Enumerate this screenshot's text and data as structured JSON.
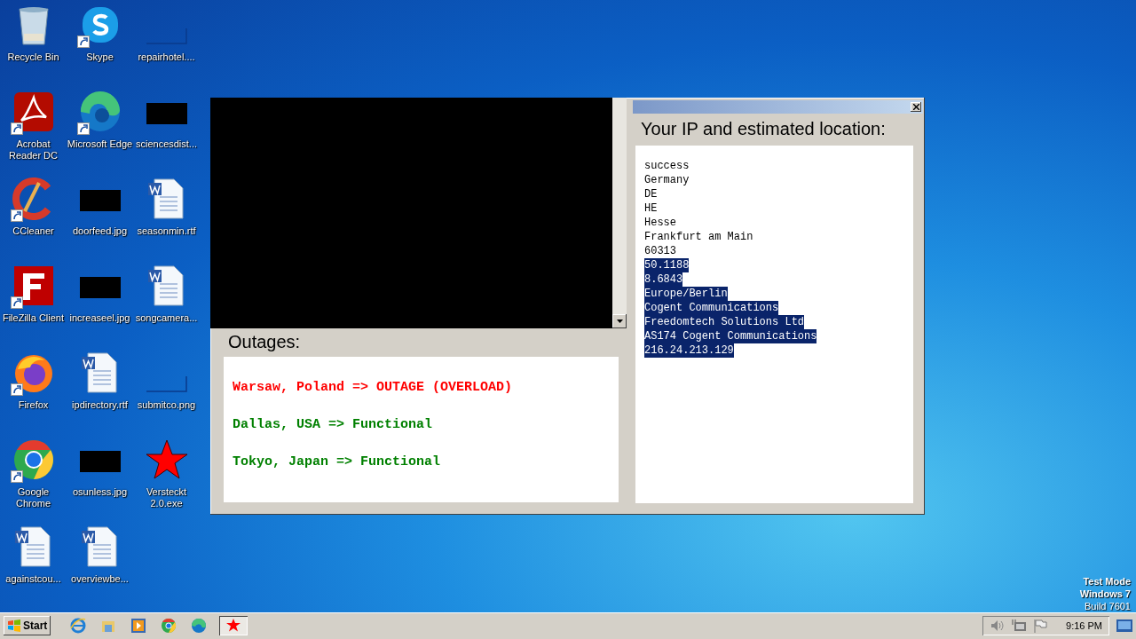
{
  "desktop": {
    "icons": [
      {
        "label": "Recycle Bin",
        "kind": "recycle",
        "shortcut": false
      },
      {
        "label": "Acrobat Reader DC",
        "kind": "acrobat",
        "shortcut": true
      },
      {
        "label": "CCleaner",
        "kind": "ccleaner",
        "shortcut": true
      },
      {
        "label": "FileZilla Client",
        "kind": "filezilla",
        "shortcut": true
      },
      {
        "label": "Firefox",
        "kind": "firefox",
        "shortcut": true
      },
      {
        "label": "Google Chrome",
        "kind": "chrome",
        "shortcut": true
      },
      {
        "label": "againstcou...",
        "kind": "word",
        "shortcut": false
      },
      {
        "label": "Skype",
        "kind": "skype",
        "shortcut": true
      },
      {
        "label": "Microsoft Edge",
        "kind": "edge",
        "shortcut": true
      },
      {
        "label": "doorfeed.jpg",
        "kind": "dark-image",
        "shortcut": false
      },
      {
        "label": "increaseel.jpg",
        "kind": "dark-image",
        "shortcut": false
      },
      {
        "label": "ipdirectory.rtf",
        "kind": "word",
        "shortcut": false
      },
      {
        "label": "osunless.jpg",
        "kind": "dark-image",
        "shortcut": false
      },
      {
        "label": "overviewbe...",
        "kind": "word",
        "shortcut": false
      },
      {
        "label": "repairhotel....",
        "kind": "blue-image",
        "shortcut": false
      },
      {
        "label": "sciencesdist...",
        "kind": "dark-image",
        "shortcut": false
      },
      {
        "label": "seasonmin.rtf",
        "kind": "word",
        "shortcut": false
      },
      {
        "label": "songcamera...",
        "kind": "word",
        "shortcut": false
      },
      {
        "label": "submitco.png",
        "kind": "blue-image",
        "shortcut": false
      },
      {
        "label": "Versteckt 2.0.exe",
        "kind": "star",
        "shortcut": false
      }
    ],
    "test_mode": [
      "Test Mode",
      "Windows 7",
      "Build 7601"
    ]
  },
  "window": {
    "location_panel": {
      "title": "Your IP and estimated location:",
      "lines": [
        {
          "text": "success",
          "selected": false
        },
        {
          "text": "Germany",
          "selected": false
        },
        {
          "text": "DE",
          "selected": false
        },
        {
          "text": "HE",
          "selected": false
        },
        {
          "text": "Hesse",
          "selected": false
        },
        {
          "text": "Frankfurt am Main",
          "selected": false
        },
        {
          "text": "60313",
          "selected": false
        },
        {
          "text": "50.1188",
          "selected": true
        },
        {
          "text": "8.6843",
          "selected": true
        },
        {
          "text": "Europe/Berlin",
          "selected": true
        },
        {
          "text": "Cogent Communications",
          "selected": true
        },
        {
          "text": "Freedomtech Solutions Ltd",
          "selected": true
        },
        {
          "text": "AS174 Cogent Communications",
          "selected": true
        },
        {
          "text": "216.24.213.129",
          "selected": true
        }
      ]
    },
    "outages": {
      "title": "Outages:",
      "lines": [
        {
          "text": "Warsaw, Poland => OUTAGE (OVERLOAD)",
          "color": "#ff0000"
        },
        {
          "text": "Dallas, USA => Functional",
          "color": "#008000"
        },
        {
          "text": "Tokyo, Japan => Functional",
          "color": "#008000"
        }
      ]
    }
  },
  "taskbar": {
    "start": "Start",
    "quick_launch": [
      {
        "kind": "ie"
      },
      {
        "kind": "explorer"
      },
      {
        "kind": "media"
      },
      {
        "kind": "chrome"
      },
      {
        "kind": "edge"
      }
    ],
    "tasks": [
      {
        "kind": "star",
        "selected": true
      }
    ],
    "tray": {
      "icons": [
        {
          "kind": "speaker"
        },
        {
          "kind": "network"
        },
        {
          "kind": "flag"
        }
      ],
      "time": "9:16 PM"
    }
  }
}
